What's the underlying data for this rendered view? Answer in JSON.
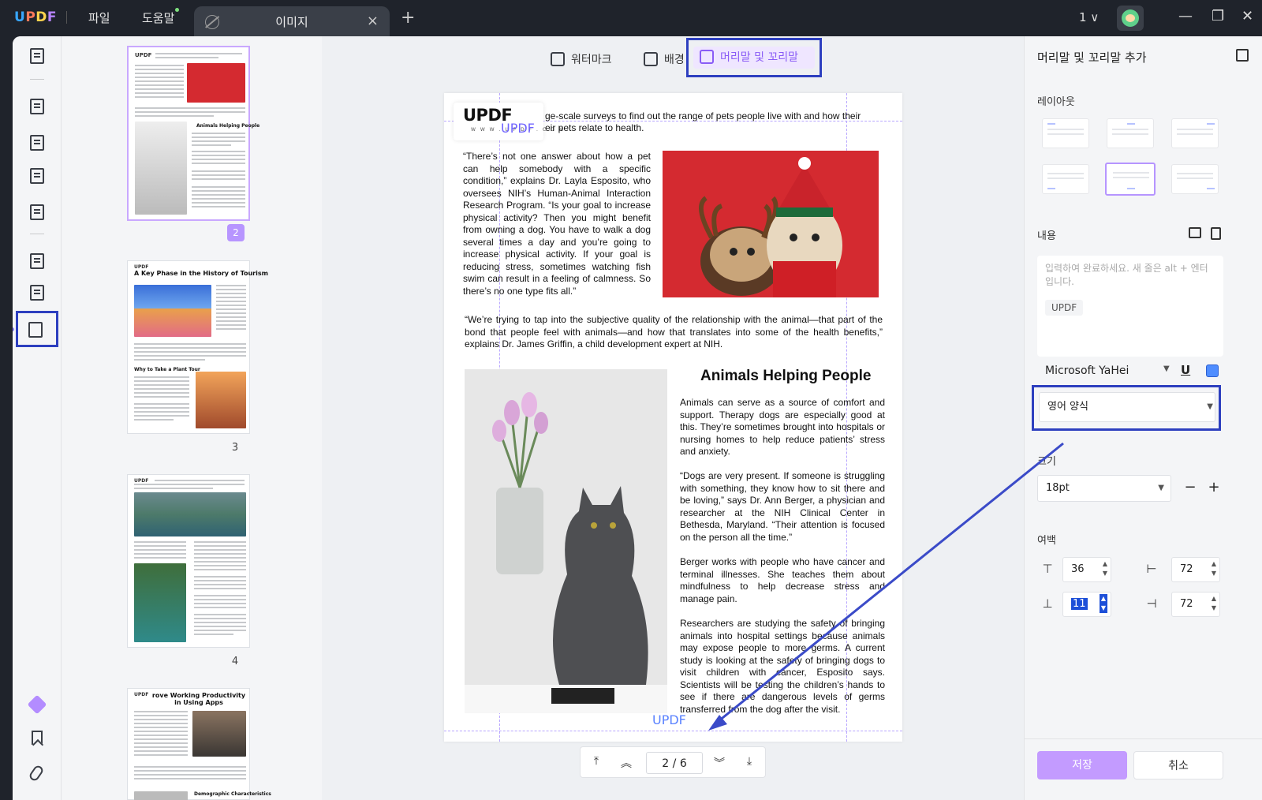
{
  "titlebar": {
    "logo_letters": [
      "U",
      "P",
      "D",
      "F"
    ],
    "menu_file": "파일",
    "menu_help": "도움말",
    "tab_title": "이미지",
    "tab_close": "×",
    "new_tab": "+",
    "page_selector": "1 ∨",
    "win_minimize": "—",
    "win_restore": "❐",
    "win_close": "✕"
  },
  "toolbar": {
    "watermark": "워터마크",
    "background": "배경",
    "header_footer": "머리말 및 꼬리말"
  },
  "thumbnails": [
    {
      "page": "2",
      "title": "Animals Helping People",
      "selected": true
    },
    {
      "page": "3",
      "title": "A Key Phase in the History of Tourism",
      "subtitle": "Why to Take a Plant Tour"
    },
    {
      "page": "4",
      "title": ""
    },
    {
      "page": "",
      "title": "rove Working Productivity in Using Apps",
      "subtitle": "Demographic Characteristics"
    }
  ],
  "document": {
    "logo": "UPDF",
    "logo_url": "W W W . U P D F . C O M",
    "header_text": "UPDF",
    "footer_text": "UPDF",
    "intro": "ge-scale surveys to find out the range of pets people live with and how their eir pets relate to health.",
    "intro_line1": "ge-scale surveys to find out the range of pets people live with and how their",
    "intro_line2": "eir pets relate to health.",
    "quote1": "“There’s not one answer about how a pet can help somebody with a specific condition,” explains Dr. Layla Esposito, who oversees NIH’s Human-Animal Interaction Research Program. “Is your goal to increase physical activity? Then you might benefit from owning a dog. You have to walk a dog several times a day and you’re going to increase physical activity. If your goal is reducing stress, sometimes watching fish swim can result in a feeling of calmness. So there’s no one type fits all.”",
    "quote2": "“We’re trying to tap into the subjective quality of the relationship with the animal—that part of the bond that people feel with animals—and how that translates into some of the health benefits,” explains Dr. James Griffin, a child development expert at NIH.",
    "heading": "Animals Helping People",
    "para1": "Animals can serve as a source of comfort and support. Therapy dogs are especially good at this. They’re sometimes brought into hospitals or nursing homes to help reduce patients’ stress and anxiety.",
    "para2": "“Dogs are very present. If someone is struggling with something, they know how to sit there and be loving,” says Dr. Ann Berger, a physician and researcher at the NIH Clinical Center in Bethesda, Maryland. “Their attention is focused on the person all the time.”",
    "para3": "Berger works with people who have cancer and terminal illnesses. She teaches them about mindfulness to help decrease stress and manage pain.",
    "para4": "Researchers are studying the safety of bringing animals into hospital settings because animals may expose people to more germs. A current study is looking at the safety of bringing dogs to visit children with cancer, Esposito says. Scientists will be testing the children’s hands to see if there are dangerous levels of germs transferred from the dog after the visit."
  },
  "pagination": {
    "current": "2",
    "sep": "/",
    "total": "6"
  },
  "panel": {
    "title": "머리말 및 꼬리말 추가",
    "layout_label": "레이아웃",
    "content_label": "내용",
    "content_placeholder": "입력하여 완료하세요. 새 줄은 alt + 엔터입니다.",
    "content_chip": "UPDF",
    "font": "Microsoft YaHei",
    "underline": "U",
    "text_color": "#4f8dff",
    "format": "영어 양식",
    "size_label": "크기",
    "size": "18pt",
    "minus": "−",
    "plus": "+",
    "margin_label": "여백",
    "margin_top": "36",
    "margin_left": "72",
    "margin_bottom": "11",
    "margin_right": "72",
    "save": "저장",
    "cancel": "취소"
  },
  "colors": {
    "highlight": "#2d3fbf",
    "accent": "#b695ff",
    "annotation_arrow": "#3b4bc8"
  }
}
